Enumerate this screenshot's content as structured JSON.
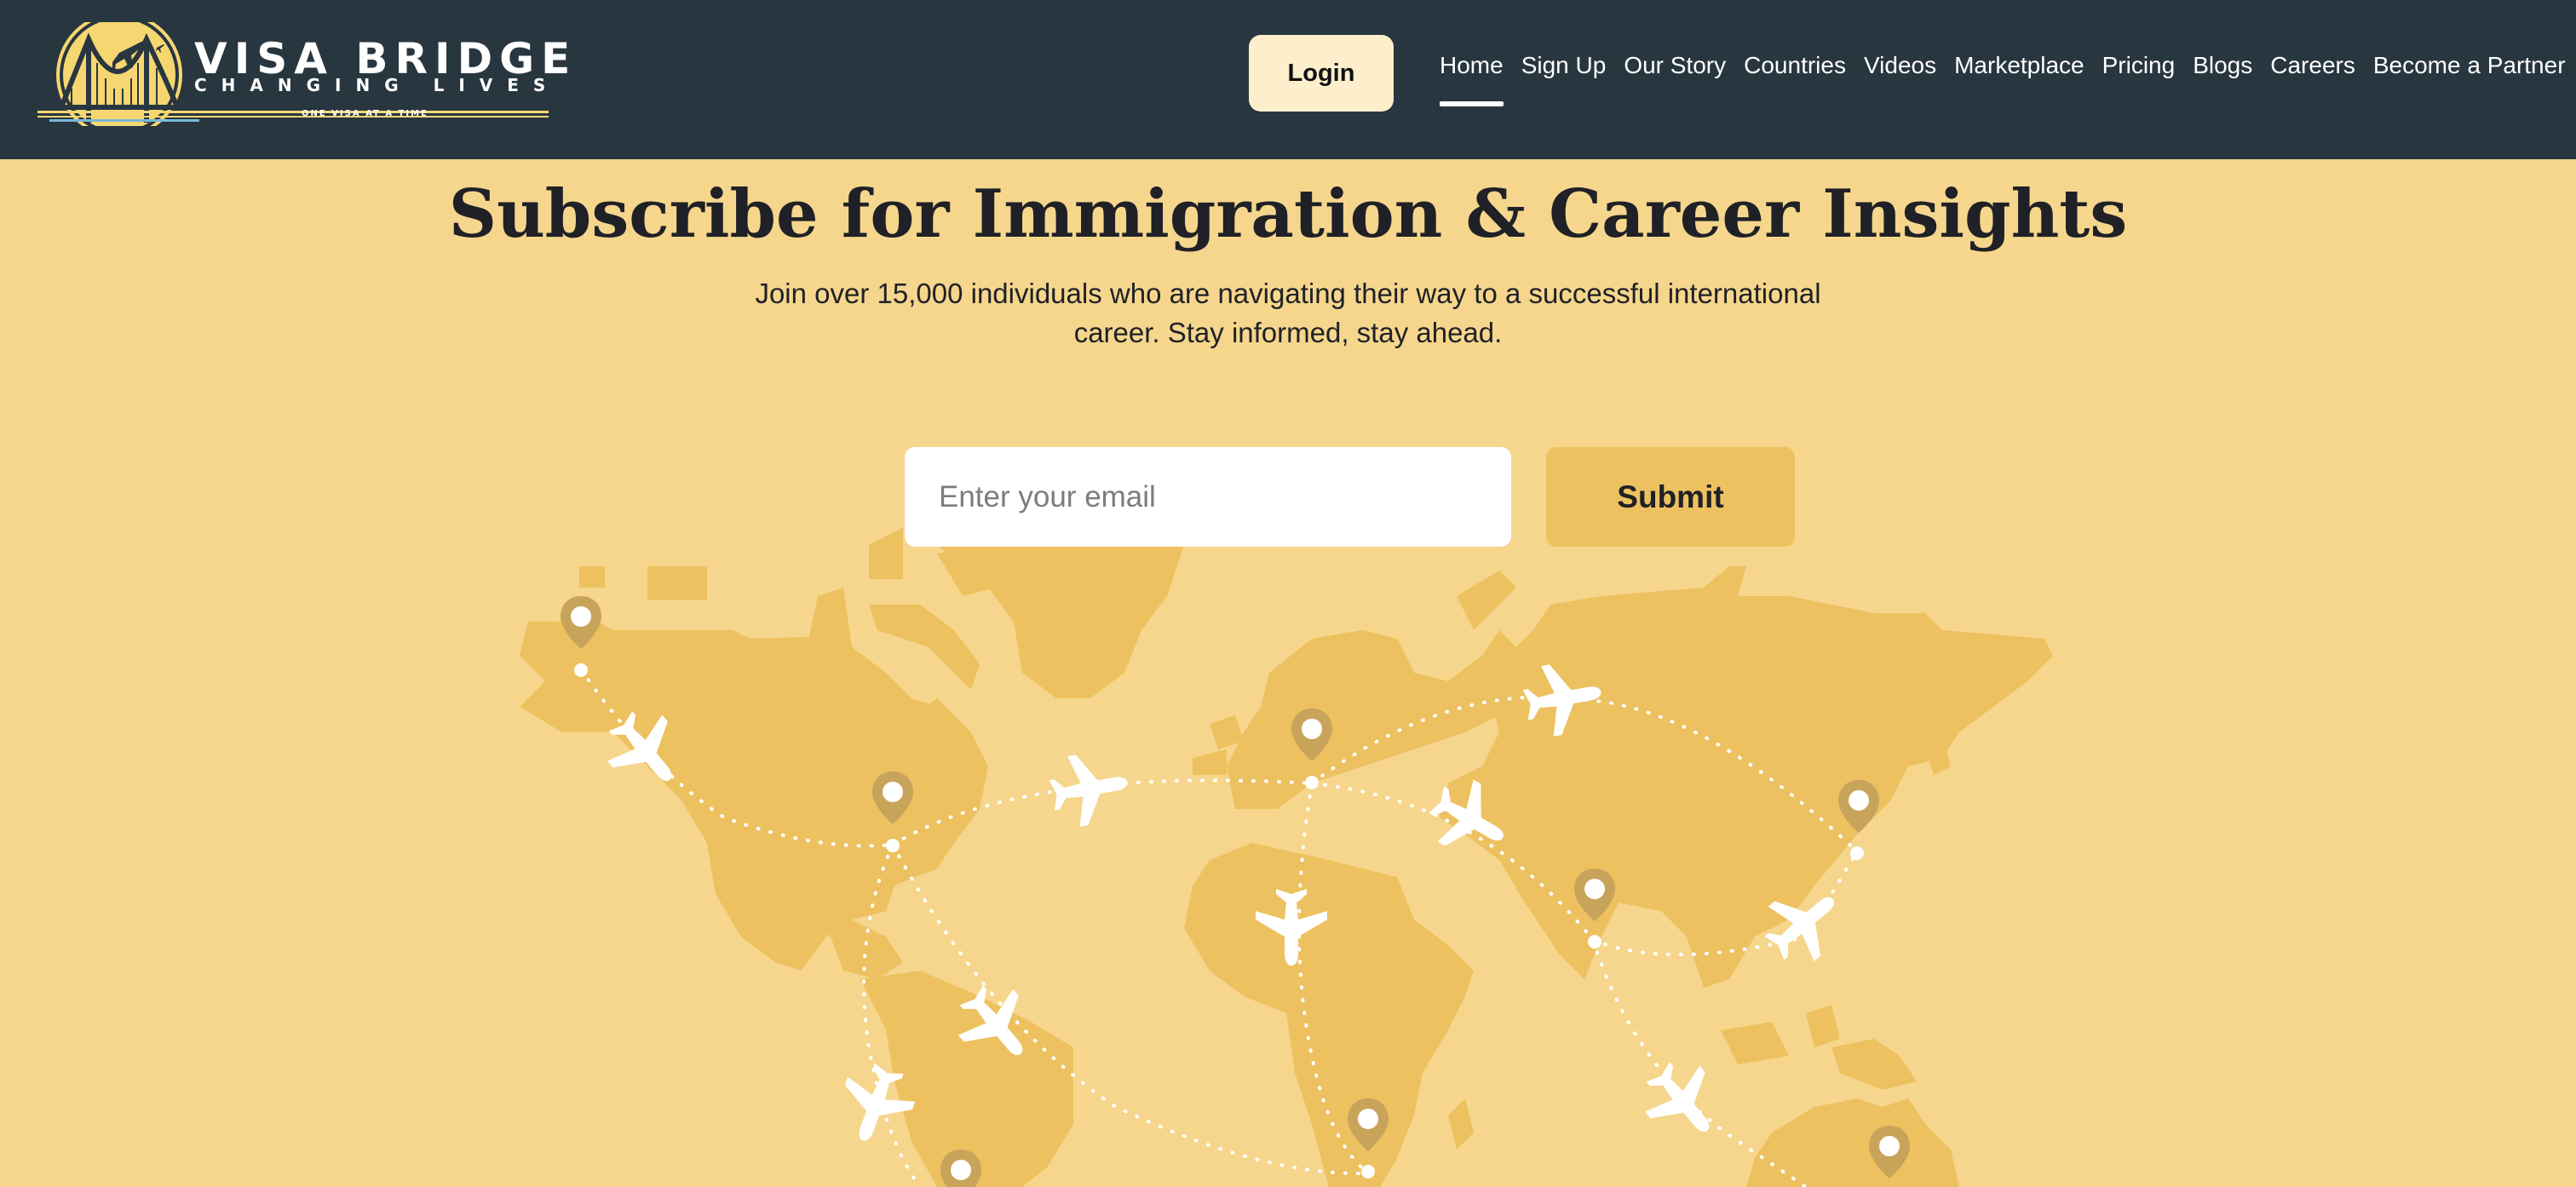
{
  "header": {
    "brand": {
      "name": "VISA BRIDGE",
      "tagline": "CHANGING LIVES",
      "motto": "ONE VISA AT A TIME"
    },
    "login_label": "Login",
    "nav": [
      {
        "label": "Home",
        "active": true
      },
      {
        "label": "Sign Up"
      },
      {
        "label": "Our Story"
      },
      {
        "label": "Countries"
      },
      {
        "label": "Videos"
      },
      {
        "label": "Marketplace"
      },
      {
        "label": "Pricing"
      },
      {
        "label": "Blogs"
      },
      {
        "label": "Careers"
      },
      {
        "label": "Become a Partner"
      }
    ]
  },
  "hero": {
    "title": "Subscribe for Immigration & Career Insights",
    "subtitle": "Join over 15,000 individuals who are navigating their way to a successful international career. Stay informed, stay ahead."
  },
  "form": {
    "email_placeholder": "Enter your email",
    "email_value": "",
    "submit_label": "Submit"
  },
  "colors": {
    "header_bg": "#283640",
    "page_bg": "#f5d68c",
    "land": "#edc160",
    "pin": "#c8a45a",
    "plane": "#ffffff",
    "login_bg": "#fdefcc",
    "submit_bg": "#edc160"
  },
  "icons": {
    "logo": "golden-gate-bridge-airplane-logo",
    "pins": "location-pin-icon",
    "planes": "airplane-icon"
  }
}
